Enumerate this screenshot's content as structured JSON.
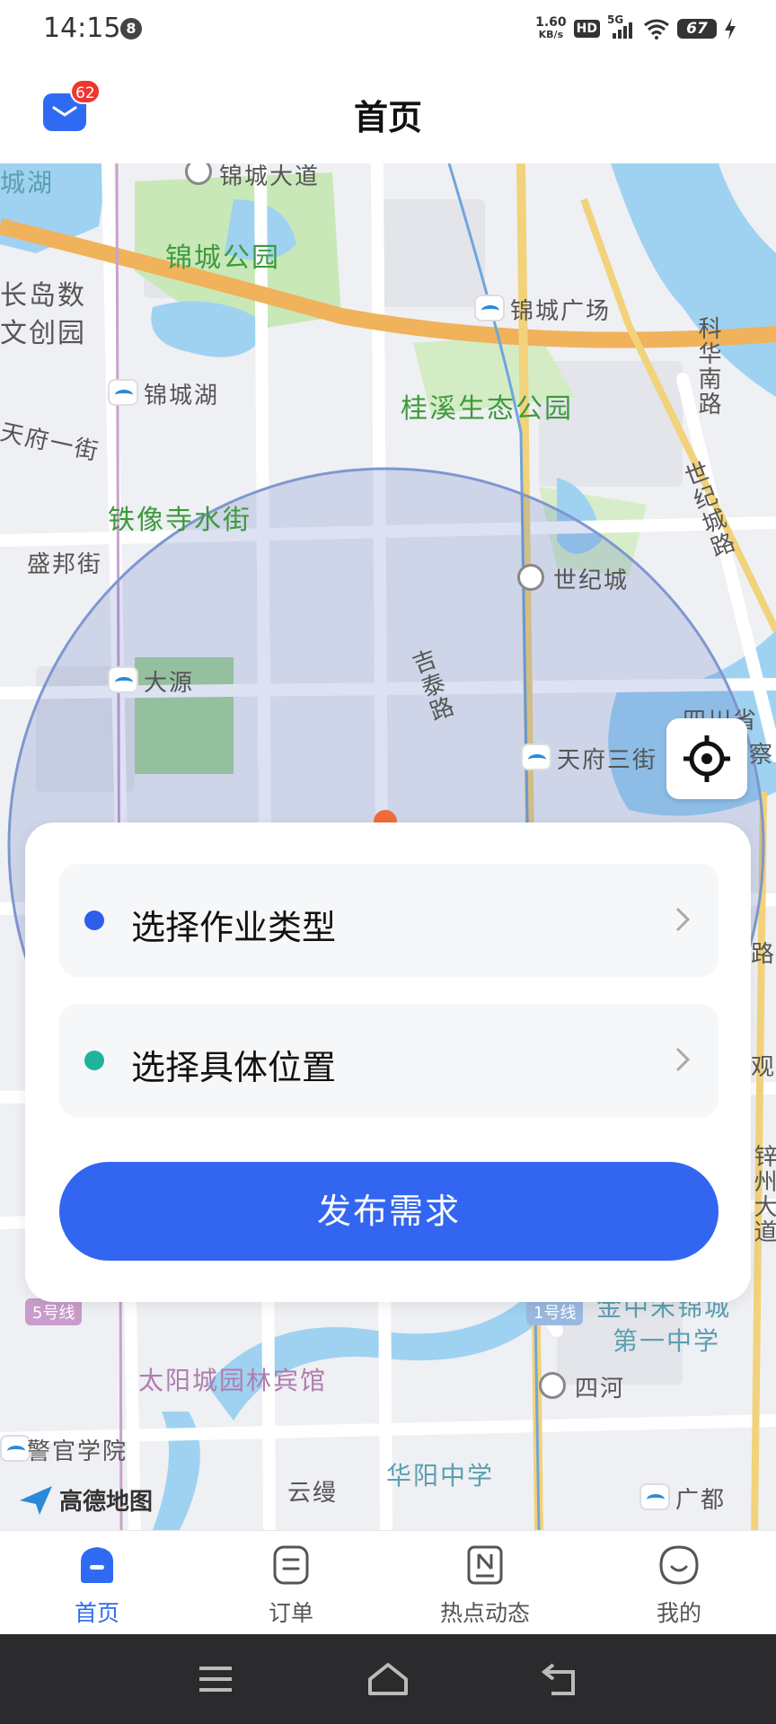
{
  "status_bar": {
    "time": "14:15",
    "notification_count": "8",
    "network_speed_value": "1.60",
    "network_speed_unit": "KB/s",
    "hd_label": "HD",
    "signal_label": "5G",
    "battery": "67"
  },
  "header": {
    "title": "首页",
    "mail_badge": "62"
  },
  "map": {
    "labels": {
      "chengdu_lake": "城湖",
      "jincheng_avenue": "锦城大道",
      "jincheng_park": "锦城公园",
      "changdao_park": "长岛数",
      "wenchuang_park": "文创园",
      "jincheng_square": "锦城广场",
      "kehua_south_road": "科华南路",
      "jincheng_lake": "锦城湖",
      "guixi_park": "桂溪生态公园",
      "tianfu_1st_street": "天府一街",
      "century_avenue": "世纪城路",
      "tiexiangsi_street": "铁像寺水街",
      "shengbang_street": "盛邦街",
      "century_city": "世纪城",
      "jitai_road": "吉泰路",
      "dayuan": "大源",
      "sichuan_province": "四川省",
      "inspection": "察",
      "tianfu_3rd_street": "天府三街",
      "road_side": "路",
      "guan": "观",
      "xinzhou_avenue": "锌州大道",
      "line5": "5号线",
      "line1": "1号线",
      "jincheng_branch": "金中宋锦城",
      "first_middle_school": "第一中学",
      "taiyangcheng_hotel": "太阳城园林宾馆",
      "sihe": "四河",
      "police_college": "警官学院",
      "yunman": "云缦",
      "huayang_school": "华阳中学",
      "guangdu": "广都",
      "amap_logo": "高德地图"
    }
  },
  "card": {
    "job_type_label": "选择作业类型",
    "location_label": "选择具体位置",
    "publish_button": "发布需求",
    "job_dot_color": "#2f5fe8",
    "location_dot_color": "#1fb39a"
  },
  "tabs": [
    {
      "label": "首页",
      "active": true
    },
    {
      "label": "订单",
      "active": false
    },
    {
      "label": "热点动态",
      "active": false
    },
    {
      "label": "我的",
      "active": false
    }
  ],
  "colors": {
    "accent": "#3366f0",
    "badge": "#f0352f"
  }
}
